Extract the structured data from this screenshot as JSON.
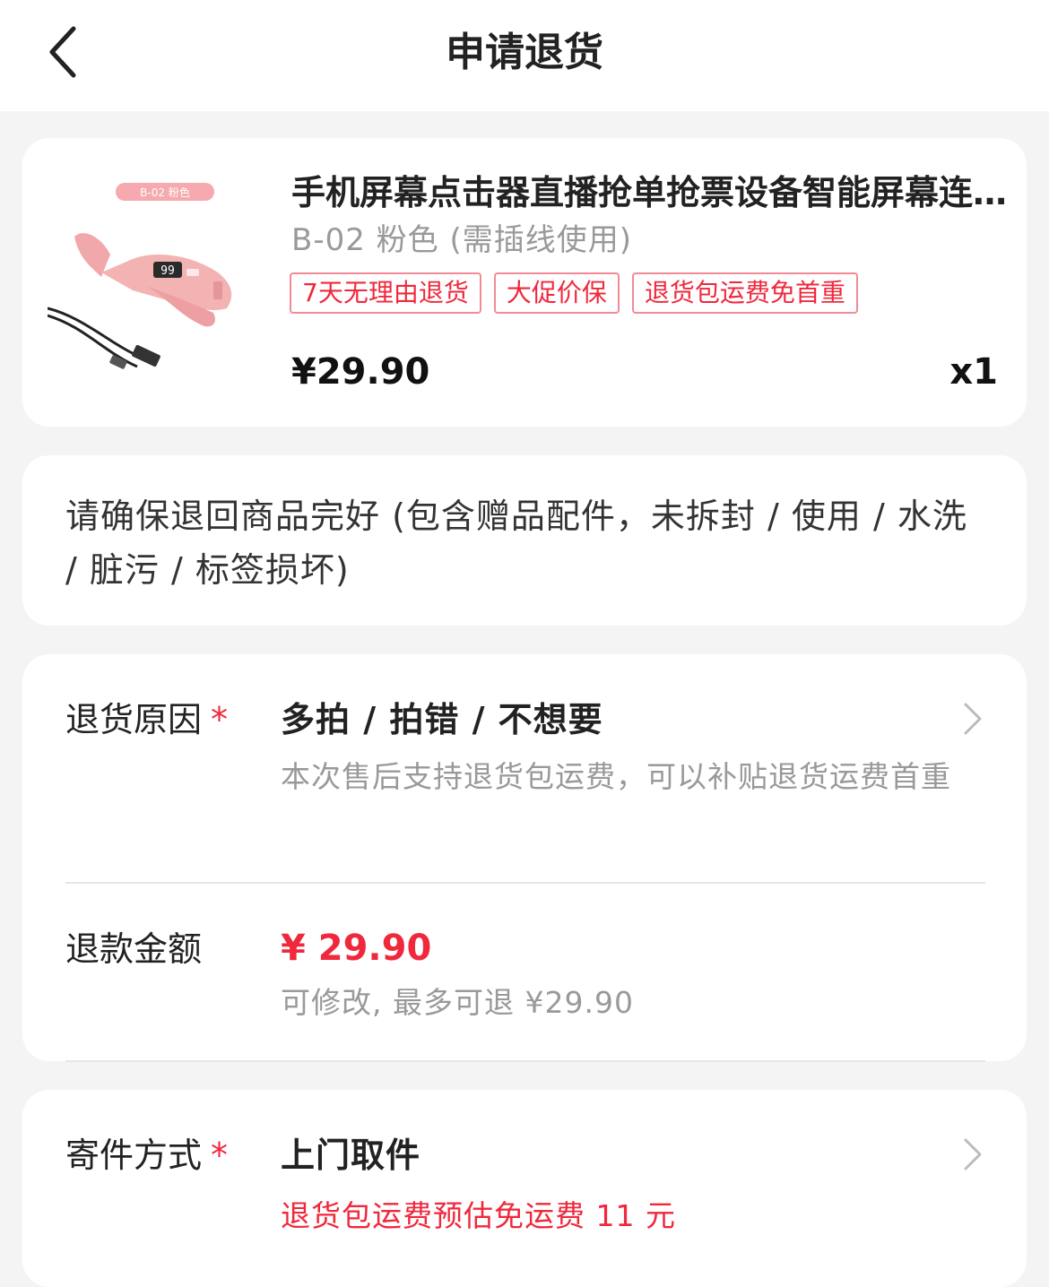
{
  "header": {
    "title": "申请退货",
    "back_icon": "chevron-left-icon"
  },
  "product": {
    "image_badge": "B-02 粉色",
    "image_display": "99",
    "name": "手机屏幕点击器直播抢单抢票设备智能屏幕连点器自动点击",
    "spec": "B-02 粉色 (需插线使用)",
    "tags": [
      "7天无理由退货",
      "大促价保",
      "退货包运费免首重"
    ],
    "price": "¥29.90",
    "quantity": "x1"
  },
  "notice": {
    "text": "请确保退回商品完好 (包含赠品配件，未拆封 / 使用 / 水洗 / 脏污 / 标签损坏)"
  },
  "return_reason": {
    "label": "退货原因",
    "required_mark": "*",
    "value": "多拍 / 拍错 / 不想要",
    "hint": "本次售后支持退货包运费，可以补贴退货运费首重"
  },
  "refund": {
    "label": "退款金额",
    "amount": "¥ 29.90",
    "hint": "可修改, 最多可退 ¥29.90"
  },
  "shipping": {
    "label": "寄件方式",
    "required_mark": "*",
    "value": "上门取件",
    "note": "退货包运费预估免运费 11 元"
  },
  "colors": {
    "accent_red": "#f0283c",
    "tag_border": "#f28b96",
    "muted_text": "#999999",
    "background": "#f4f4f4"
  }
}
